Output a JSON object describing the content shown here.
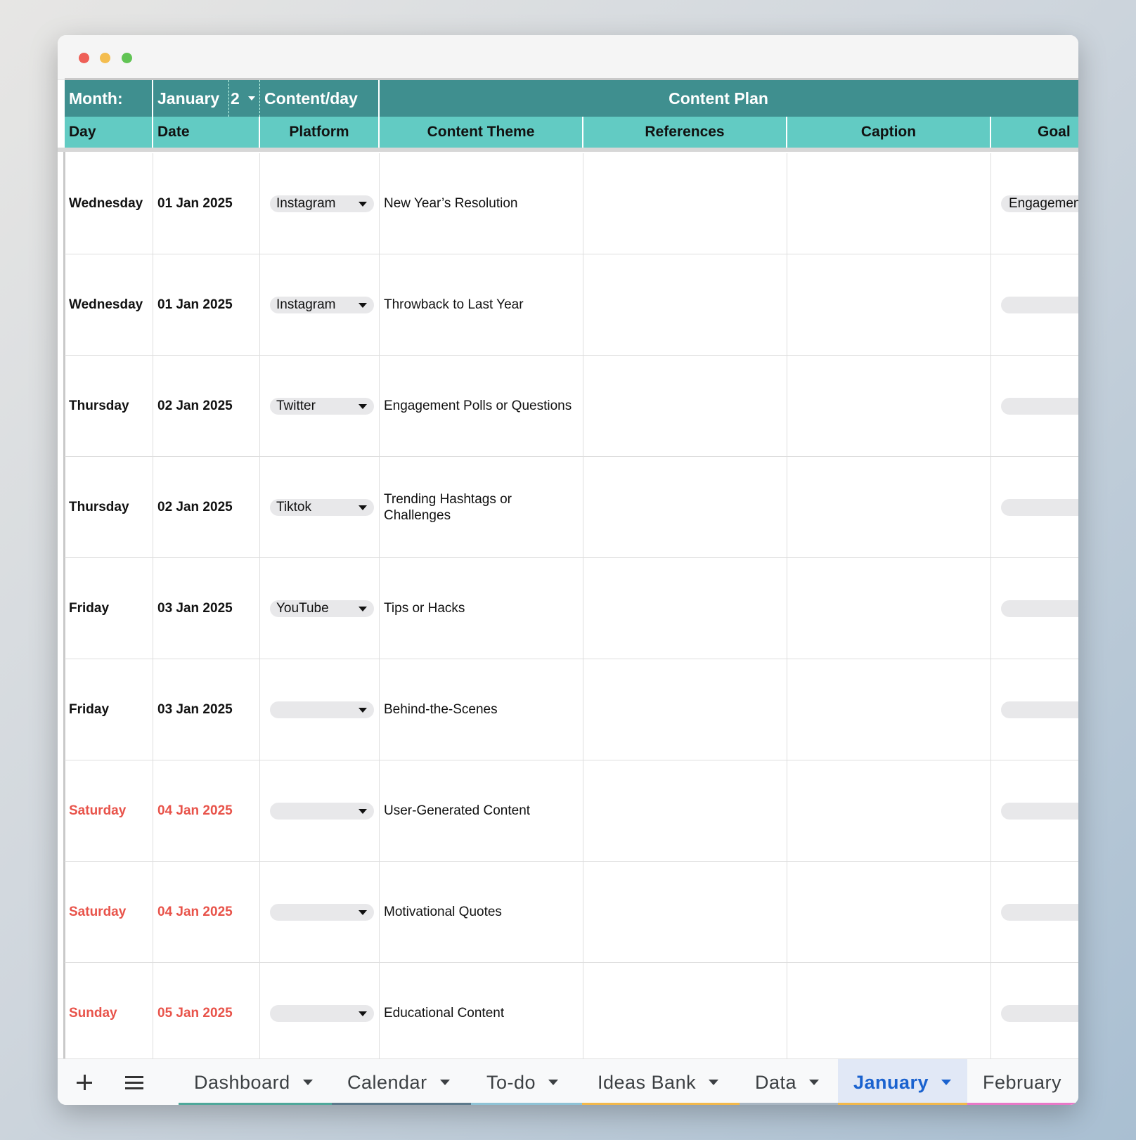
{
  "header": {
    "month_label": "Month:",
    "month_value": "January",
    "content_per_day_value": "2",
    "content_per_day_label": "Content/day",
    "content_plan_label": "Content Plan"
  },
  "columns": {
    "day": "Day",
    "date": "Date",
    "platform": "Platform",
    "content_theme": "Content Theme",
    "references": "References",
    "caption": "Caption",
    "goal": "Goal"
  },
  "rows": [
    {
      "day": "Wednesday",
      "date": "01 Jan 2025",
      "platform": "Instagram",
      "theme": "New Year’s Resolution",
      "goal": "Engagement",
      "weekend": false
    },
    {
      "day": "Wednesday",
      "date": "01 Jan 2025",
      "platform": "Instagram",
      "theme": "Throwback to Last Year",
      "goal": "",
      "weekend": false
    },
    {
      "day": "Thursday",
      "date": "02 Jan 2025",
      "platform": "Twitter",
      "theme": "Engagement Polls or Questions",
      "goal": "",
      "weekend": false
    },
    {
      "day": "Thursday",
      "date": "02 Jan 2025",
      "platform": "Tiktok",
      "theme": "Trending Hashtags or Challenges",
      "goal": "",
      "weekend": false
    },
    {
      "day": "Friday",
      "date": "03 Jan 2025",
      "platform": "YouTube",
      "theme": "Tips or Hacks",
      "goal": "",
      "weekend": false
    },
    {
      "day": "Friday",
      "date": "03 Jan 2025",
      "platform": "",
      "theme": "Behind-the-Scenes",
      "goal": "",
      "weekend": false
    },
    {
      "day": "Saturday",
      "date": "04 Jan 2025",
      "platform": "",
      "theme": "User-Generated Content",
      "goal": "",
      "weekend": true
    },
    {
      "day": "Saturday",
      "date": "04 Jan 2025",
      "platform": "",
      "theme": "Motivational Quotes",
      "goal": "",
      "weekend": true
    },
    {
      "day": "Sunday",
      "date": "05 Jan 2025",
      "platform": "",
      "theme": "Educational Content",
      "goal": "",
      "weekend": true
    }
  ],
  "tabs": [
    {
      "label": "Dashboard",
      "color": "#4fa89a",
      "active": false
    },
    {
      "label": "Calendar",
      "color": "#5d7a8c",
      "active": false
    },
    {
      "label": "To-do",
      "color": "#8fc3d6",
      "active": false
    },
    {
      "label": "Ideas Bank",
      "color": "#f2b84b",
      "active": false
    },
    {
      "label": "Data",
      "color": "#a9b6c2",
      "active": false
    },
    {
      "label": "January",
      "color": "#f2b84b",
      "active": true
    },
    {
      "label": "February",
      "color": "#e879c8",
      "active": false
    }
  ],
  "colors": {
    "header_dark": "#3f8f8f",
    "header_light": "#62cbc3",
    "weekend_text": "#e8534a",
    "active_tab": "#1a62cf"
  }
}
